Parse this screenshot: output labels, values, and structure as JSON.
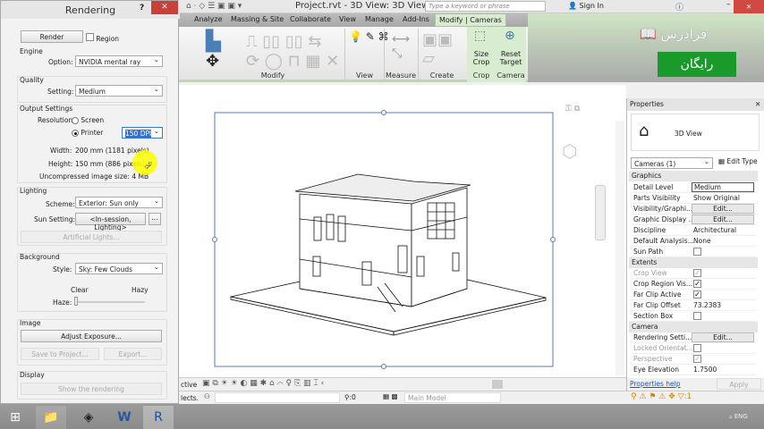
{
  "app": {
    "title": "Project.rvt - 3D View: 3D View...",
    "search_placeholder": "Type a keyword or phrase",
    "sign_in": "Sign In"
  },
  "tabs": [
    "Analyze",
    "Massing & Site",
    "Collaborate",
    "View",
    "Manage",
    "Add-Ins",
    "Modify | Cameras"
  ],
  "ribbon": {
    "panels": [
      "Modify",
      "View",
      "Measure",
      "Create",
      "Crop",
      "Camera"
    ],
    "size_crop": "Size Crop",
    "reset_target": "Reset Target"
  },
  "watermark": {
    "logo": "فرادرس",
    "badge": "رایگان",
    "badge_color": "#1a9a2a"
  },
  "dialog": {
    "title": "Rendering",
    "help": "?",
    "render": "Render",
    "region": "Region",
    "engine": {
      "header": "Engine",
      "option_label": "Option:",
      "option": "NVIDIA mental ray"
    },
    "quality": {
      "header": "Quality",
      "setting_label": "Setting:",
      "setting": "Medium"
    },
    "output": {
      "header": "Output Settings",
      "resolution_label": "Resolution:",
      "screen": "Screen",
      "printer": "Printer",
      "dpi": "150 DPI",
      "width_label": "Width:",
      "width": "200 mm (1181 pixels)",
      "height_label": "Height:",
      "height": "150 mm (886 pixels)",
      "size_label": "Uncompressed image size:",
      "size": "4 MB"
    },
    "lighting": {
      "header": "Lighting",
      "scheme_label": "Scheme:",
      "scheme": "Exterior: Sun only",
      "sun_label": "Sun Setting:",
      "sun": "<In-session, Lighting>",
      "more": "...",
      "artificial": "Artificial Lights..."
    },
    "background": {
      "header": "Background",
      "style_label": "Style:",
      "style": "Sky: Few Clouds",
      "clear": "Clear",
      "hazy": "Hazy",
      "haze_label": "Haze:",
      "haze_value": 0
    },
    "image": {
      "header": "Image",
      "adjust": "Adjust Exposure...",
      "save": "Save to Project...",
      "export": "Export..."
    },
    "display": {
      "header": "Display",
      "show": "Show the rendering"
    }
  },
  "properties": {
    "title": "Properties",
    "type": "3D View",
    "selector": "Cameras (1)",
    "edit_type": "Edit Type",
    "categories": {
      "graphics": "Graphics",
      "extents": "Extents",
      "camera": "Camera"
    },
    "graphics": [
      {
        "k": "Detail Level",
        "v": "Medium"
      },
      {
        "k": "Parts Visibility",
        "v": "Show Original"
      },
      {
        "k": "Visibility/Graphi...",
        "btn": "Edit..."
      },
      {
        "k": "Graphic Display ...",
        "btn": "Edit..."
      },
      {
        "k": "Discipline",
        "v": "Architectural"
      },
      {
        "k": "Default Analysis...",
        "v": "None"
      },
      {
        "k": "Sun Path",
        "check": false
      }
    ],
    "extents": [
      {
        "k": "Crop View",
        "check": true,
        "gray": true
      },
      {
        "k": "Crop Region Vis...",
        "check": true
      },
      {
        "k": "Far Clip Active",
        "check": true
      },
      {
        "k": "Far Clip Offset",
        "v": "73.2383"
      },
      {
        "k": "Section Box",
        "check": false
      }
    ],
    "camera": [
      {
        "k": "Rendering Setti...",
        "btn": "Edit..."
      },
      {
        "k": "Locked Orientat...",
        "check": false,
        "gray": true
      },
      {
        "k": "Perspective",
        "check": true,
        "gray": true
      },
      {
        "k": "Eye Elevation",
        "v": "1.7500"
      }
    ],
    "help": "Properties help",
    "apply": "Apply"
  },
  "status": {
    "active": "ctive",
    "selects": "lects.",
    "count": ":0",
    "model": "Main Model",
    "filter": ":1"
  },
  "taskbar": {
    "lang": "ENG"
  }
}
